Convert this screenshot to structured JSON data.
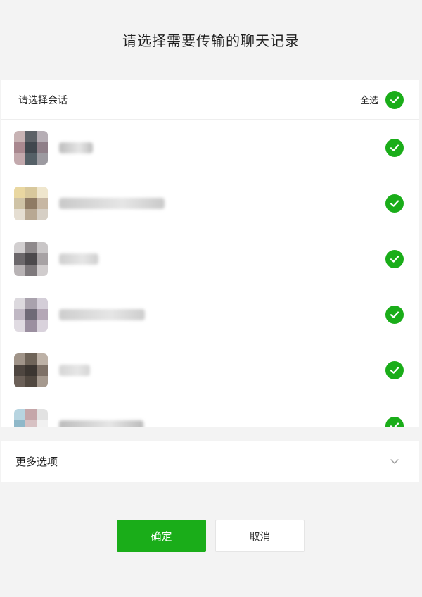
{
  "dialog": {
    "title": "请选择需要传输的聊天记录"
  },
  "panel": {
    "select_label": "请选择会话",
    "select_all_label": "全选"
  },
  "conversations": [
    {
      "selected": true,
      "name_width": 48,
      "avatar": [
        "#c8b3b4",
        "#5d6268",
        "#b6aeb5",
        "#a9888f",
        "#40474e",
        "#8f7f88",
        "#c3a9ad",
        "#556067",
        "#9c9aa0"
      ],
      "name_color": "#bdbdbd"
    },
    {
      "selected": true,
      "name_width": 150,
      "avatar": [
        "#e9d7a1",
        "#d8c89c",
        "#efe6cd",
        "#cfc3a6",
        "#8f7b64",
        "#c7b7a3",
        "#e5ded2",
        "#b8a893",
        "#d6cfc5"
      ],
      "name_color": "#c9c9c9"
    },
    {
      "selected": true,
      "name_width": 56,
      "avatar": [
        "#d2cfd0",
        "#8f8a8c",
        "#c9c6c7",
        "#6c686b",
        "#4c494c",
        "#a7a2a4",
        "#b8b3b5",
        "#7e797c",
        "#d0cccd"
      ],
      "name_color": "#cfcfcf"
    },
    {
      "selected": true,
      "name_width": 122,
      "avatar": [
        "#dcd9de",
        "#a9a2ad",
        "#d4ced8",
        "#c0b8c4",
        "#6f6a77",
        "#b4a7b6",
        "#e0dbe2",
        "#9b8fa0",
        "#d9d2dc"
      ],
      "name_color": "#cdcdcd"
    },
    {
      "selected": true,
      "name_width": 44,
      "avatar": [
        "#a09489",
        "#6f6459",
        "#bdb1a6",
        "#4e4640",
        "#3c3631",
        "#7e7167",
        "#6b6058",
        "#514840",
        "#a5998e"
      ],
      "name_color": "#d5d5d5"
    },
    {
      "selected": true,
      "name_width": 120,
      "avatar": [
        "#b7d4e0",
        "#c5a6a9",
        "#e2e2e2",
        "#8fb8c9",
        "#d7c1c3",
        "#f1f1f1",
        "#ffffff",
        "#ffffff",
        "#ffffff"
      ],
      "name_color": "#bcbcbc"
    }
  ],
  "more_options": {
    "label": "更多选项",
    "icon": "chevron-down-icon"
  },
  "buttons": {
    "confirm": "确定",
    "cancel": "取消"
  },
  "colors": {
    "accent": "#1aad19",
    "background": "#f3f3f3"
  }
}
